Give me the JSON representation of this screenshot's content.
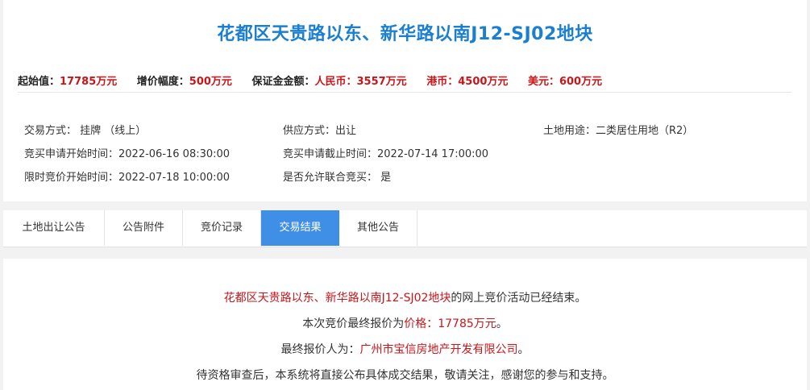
{
  "title": "花都区天贵路以东、新华路以南J12-SJ02地块",
  "prices": {
    "start_label": "起始值：",
    "start_value": "17785万元",
    "increment_label": "增价幅度：",
    "increment_value": "500万元",
    "deposit_label": "保证金金额：",
    "rmb_label": "人民币：",
    "rmb_value": "3557万元",
    "hkd_label": "港币：",
    "hkd_value": "4500万元",
    "usd_label": "美元：",
    "usd_value": "600万元"
  },
  "info": {
    "trade_method": "交易方式： 挂牌 （线上）",
    "supply_method": "供应方式：出让",
    "land_use": "土地用途：二类居住用地（R2）",
    "apply_start": "竞买申请开始时间：2022-06-16 08:30:00",
    "apply_end": "竞买申请截止时间：2022-07-14 17:00:00",
    "bid_start": "限时竞价开始时间：2022-07-18 10:00:00",
    "joint_bid": "是否允许联合竞买： 是"
  },
  "tabs": [
    {
      "label": "土地出让公告",
      "active": false
    },
    {
      "label": "公告附件",
      "active": false
    },
    {
      "label": "竞价记录",
      "active": false
    },
    {
      "label": "交易结果",
      "active": true
    },
    {
      "label": "其他公告",
      "active": false
    }
  ],
  "result": {
    "line1_red": "花都区天贵路以东、新华路以南J12-SJ02地块",
    "line1_rest": "的网上竞价活动已经结束。",
    "line2_prefix": "本次竞价最终报价为",
    "line2_red": "价格：17785万元",
    "line2_suffix": "。",
    "line3_prefix": "最终报价人为：",
    "line3_red": "广州市宝信房地产开发有限公司",
    "line3_suffix": "。",
    "line4": "待资格审查后，本系统将直接公布具体成交结果，敬请关注，感谢您的参与和支持。"
  },
  "colors": {
    "title_blue": "#1a7fd1",
    "accent_red": "#c9161a",
    "tab_active_bg": "#3f8fe6"
  }
}
